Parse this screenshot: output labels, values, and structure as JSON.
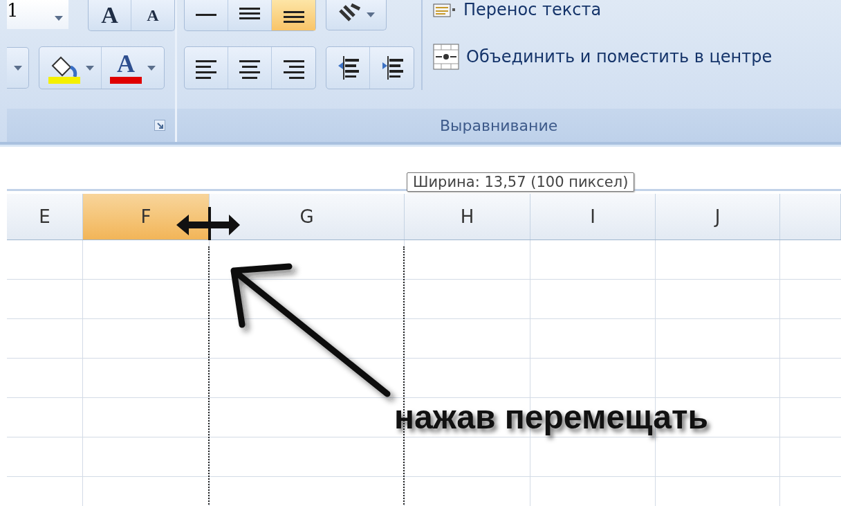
{
  "ribbon": {
    "font_group": {
      "font_size": "1",
      "size_buttons": [
        "A",
        "A"
      ],
      "font_color_button": "A"
    },
    "alignment_group": {
      "vertical_align_buttons": [
        {
          "selected": false
        },
        {
          "selected": false
        },
        {
          "selected": true
        }
      ],
      "horizontal_align_buttons": [
        {
          "selected": false
        },
        {
          "selected": false
        },
        {
          "selected": false
        }
      ],
      "wrap_text": "Перенос текста",
      "merge_center": "Объединить и поместить в центре",
      "label": "Выравнивание"
    }
  },
  "tooltip": "Ширина: 13,57 (100 пиксел)",
  "columns": [
    {
      "label": "E",
      "selected": false
    },
    {
      "label": "F",
      "selected": true
    },
    {
      "label": "G",
      "selected": false
    },
    {
      "label": "H",
      "selected": false
    },
    {
      "label": "I",
      "selected": false
    },
    {
      "label": "J",
      "selected": false
    }
  ],
  "annotation": "нажав перемещать"
}
